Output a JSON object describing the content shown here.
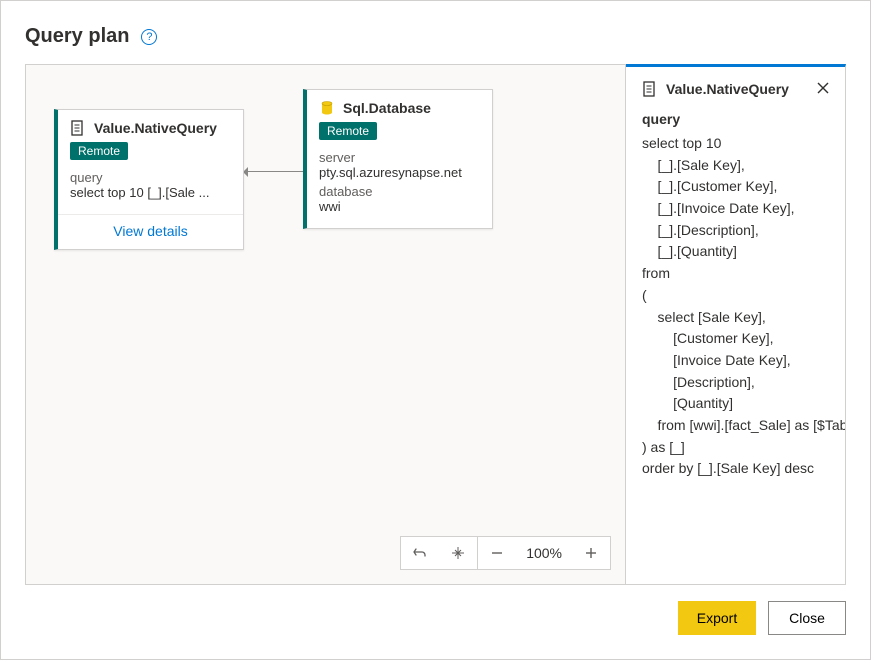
{
  "dialog": {
    "title": "Query plan",
    "export_label": "Export",
    "close_label": "Close"
  },
  "canvas": {
    "nodes": [
      {
        "title": "Value.NativeQuery",
        "tag": "Remote",
        "query_label": "query",
        "query_preview": "select top 10 [_].[Sale ...",
        "view_details_label": "View details"
      },
      {
        "title": "Sql.Database",
        "tag": "Remote",
        "server_label": "server",
        "server_value": "pty.sql.azuresynapse.net",
        "database_label": "database",
        "database_value": "wwi"
      }
    ],
    "zoom": {
      "percent_label": "100%"
    }
  },
  "details": {
    "title": "Value.NativeQuery",
    "query_label": "query",
    "query_text": "select top 10\n    [_].[Sale Key],\n    [_].[Customer Key],\n    [_].[Invoice Date Key],\n    [_].[Description],\n    [_].[Quantity]\nfrom\n(\n    select [Sale Key],\n        [Customer Key],\n        [Invoice Date Key],\n        [Description],\n        [Quantity]\n    from [wwi].[fact_Sale] as [$Table]\n) as [_]\norder by [_].[Sale Key] desc"
  }
}
